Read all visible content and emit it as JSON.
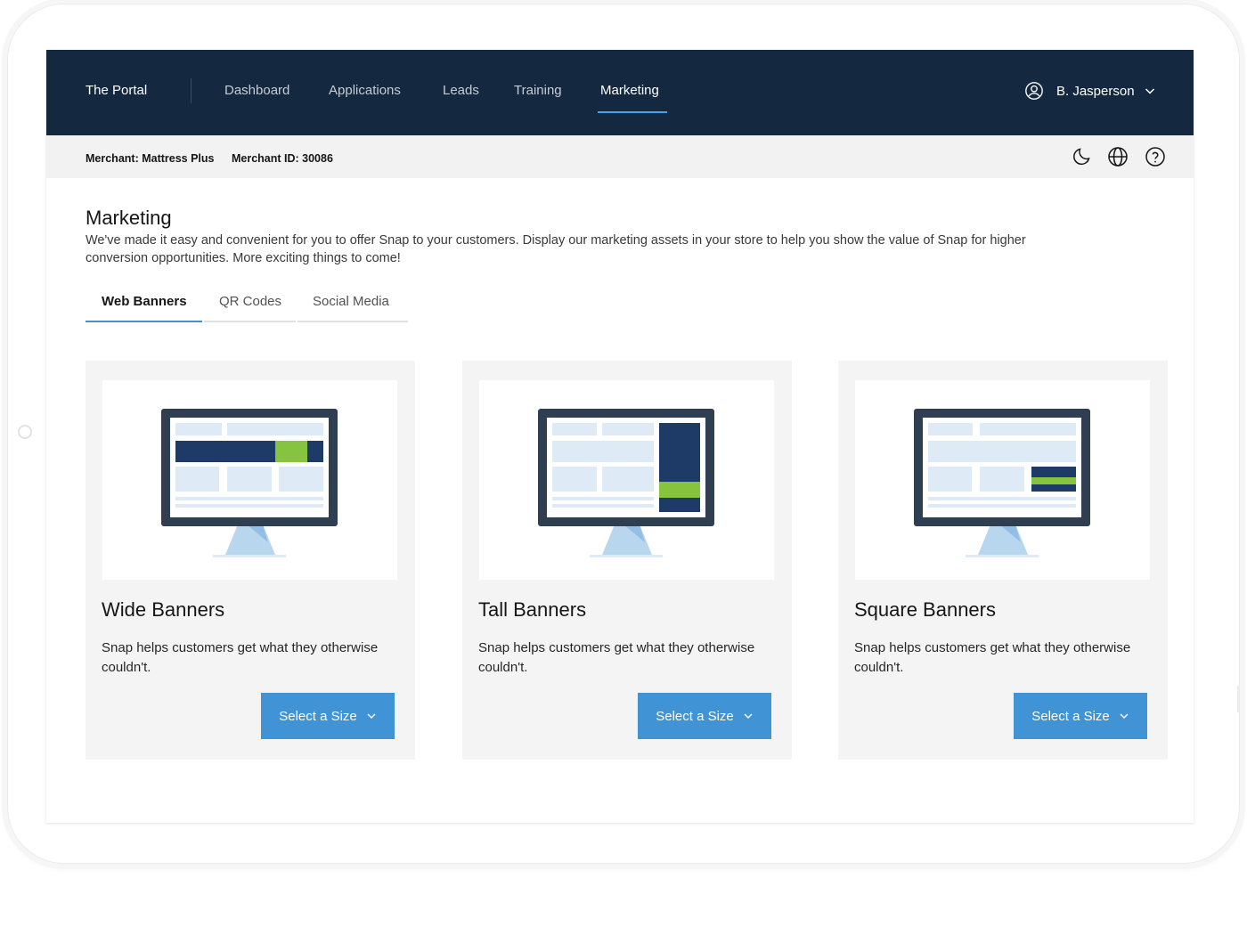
{
  "header": {
    "brand": "The Portal",
    "nav": [
      {
        "label": "Dashboard",
        "active": false
      },
      {
        "label": "Applications",
        "active": false
      },
      {
        "label": "Leads",
        "active": false
      },
      {
        "label": "Training",
        "active": false
      },
      {
        "label": "Marketing",
        "active": true
      }
    ],
    "user": {
      "name": "B. Jasperson",
      "icon": "user-avatar-icon"
    }
  },
  "merchant_bar": {
    "merchant": "Merchant: Mattress Plus",
    "merchant_id": "Merchant ID: 30086",
    "icons": [
      "moon-icon",
      "globe-icon",
      "help-icon"
    ]
  },
  "page": {
    "title": "Marketing",
    "description": "We've made it easy and convenient for you to offer Snap to your customers. Display our marketing assets in your store to help you show the value of Snap for higher conversion opportunities. More exciting things to come!"
  },
  "tabs": [
    {
      "label": "Web Banners",
      "active": true
    },
    {
      "label": "QR Codes",
      "active": false
    },
    {
      "label": "Social Media",
      "active": false
    }
  ],
  "cards": [
    {
      "title": "Wide Banners",
      "description": "Snap helps customers get what they otherwise couldn't.",
      "button": "Select a Size",
      "illustration": "wide-banner-monitor"
    },
    {
      "title": "Tall Banners",
      "description": "Snap helps customers get what they otherwise couldn't.",
      "button": "Select a Size",
      "illustration": "tall-banner-monitor"
    },
    {
      "title": "Square Banners",
      "description": "Snap helps customers get what they otherwise couldn't.",
      "button": "Select a Size",
      "illustration": "square-banner-monitor"
    }
  ],
  "colors": {
    "nav_bg": "#142840",
    "accent": "#4093d4",
    "banner_navy": "#1e3a66",
    "banner_green": "#86c440",
    "monitor_frame": "#2f3e50",
    "placeholder": "#deebf7"
  }
}
